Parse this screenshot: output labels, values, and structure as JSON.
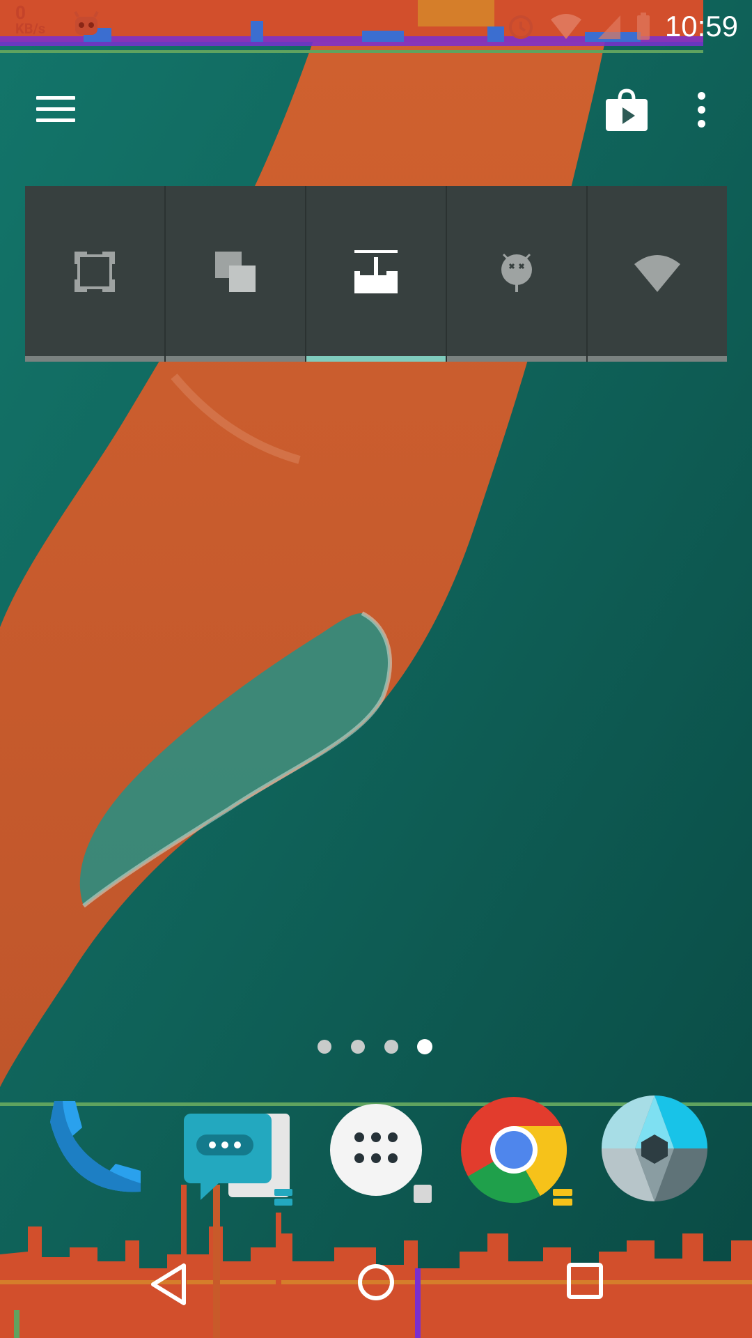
{
  "status_bar": {
    "net_speed_value": "0",
    "net_speed_unit": "KB/s",
    "time": "10:59",
    "icons": [
      "cyanogen-icon",
      "alarm-icon",
      "wifi-icon",
      "signal-icon",
      "battery-icon"
    ]
  },
  "top_bar": {
    "icons": [
      "menu-icon",
      "play-store-icon",
      "overflow-icon"
    ]
  },
  "widget": {
    "tiles": [
      {
        "name": "fullscreen",
        "icon": "fullscreen-icon",
        "active": false
      },
      {
        "name": "overlay",
        "icon": "overlay-icon",
        "active": false
      },
      {
        "name": "gpu-profile",
        "icon": "gpu-profile-icon",
        "active": true
      },
      {
        "name": "android-debug",
        "icon": "android-debug-icon",
        "active": false
      },
      {
        "name": "wifi",
        "icon": "wifi-icon",
        "active": false
      }
    ],
    "accent_color": "#7fcbbd"
  },
  "home_pages": {
    "count": 4,
    "current_index": 3
  },
  "dock": {
    "apps": [
      {
        "name": "phone",
        "icon": "phone-icon"
      },
      {
        "name": "messenger",
        "icon": "messenger-icon"
      },
      {
        "name": "app-drawer",
        "icon": "app-drawer-icon"
      },
      {
        "name": "chrome",
        "icon": "chrome-icon"
      },
      {
        "name": "camera",
        "icon": "camera-icon"
      }
    ]
  },
  "nav_bar": {
    "buttons": [
      "back-icon",
      "home-icon",
      "recents-icon"
    ]
  }
}
